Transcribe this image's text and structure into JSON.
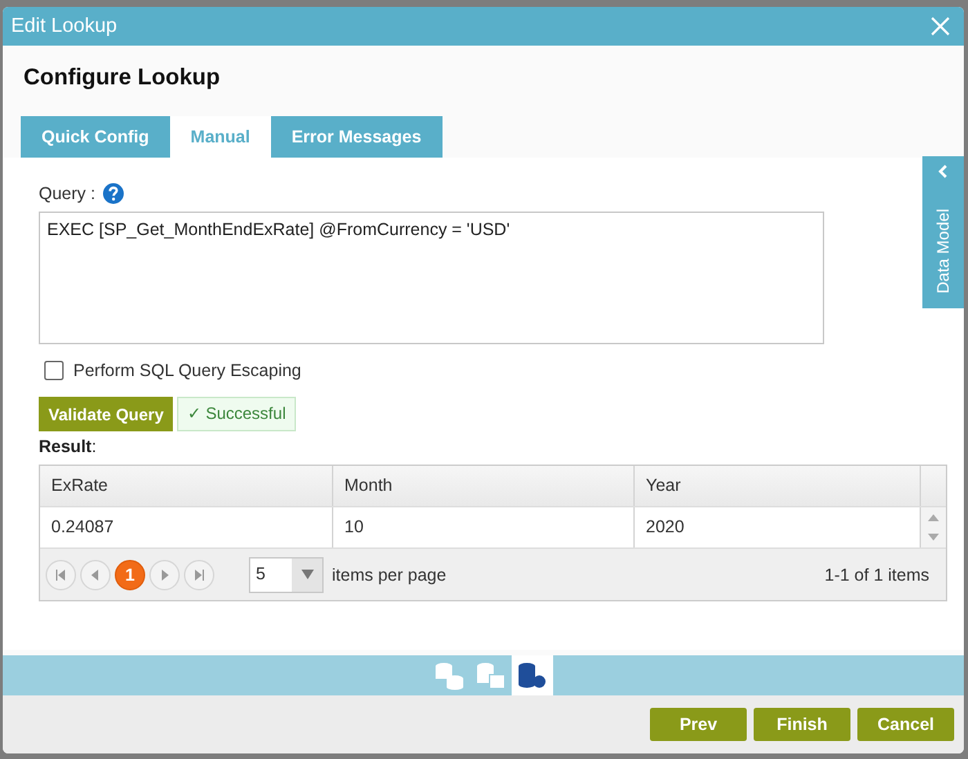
{
  "window": {
    "title": "Edit Lookup"
  },
  "heading": "Configure Lookup",
  "tabs": [
    {
      "label": "Quick Config",
      "selected": false
    },
    {
      "label": "Manual",
      "selected": true
    },
    {
      "label": "Error Messages",
      "selected": false
    }
  ],
  "side_tab": {
    "label": "Data Model"
  },
  "query": {
    "label": "Query :",
    "value": "EXEC [SP_Get_MonthEndExRate] @FromCurrency = 'USD'"
  },
  "escaping": {
    "label": "Perform SQL Query Escaping",
    "checked": false
  },
  "validate_button": "Validate Query",
  "validation_status": "✓ Successful",
  "result_label": "**Result**:",
  "table": {
    "columns": [
      "ExRate",
      "Month",
      "Year"
    ],
    "rows": [
      [
        "0.24087",
        "10",
        "2020"
      ]
    ]
  },
  "pager": {
    "pages": [
      {
        "label": "1",
        "selected": true
      }
    ],
    "page_size": "5",
    "page_size_label": "items per page",
    "summary": "1-1 of 1 items"
  },
  "toolbar_icons": [
    {
      "kind": "databases",
      "selected": false
    },
    {
      "kind": "database-table",
      "selected": false
    },
    {
      "kind": "database-settings",
      "selected": true
    }
  ],
  "buttons": [
    "Prev",
    "Finish",
    "Cancel"
  ]
}
